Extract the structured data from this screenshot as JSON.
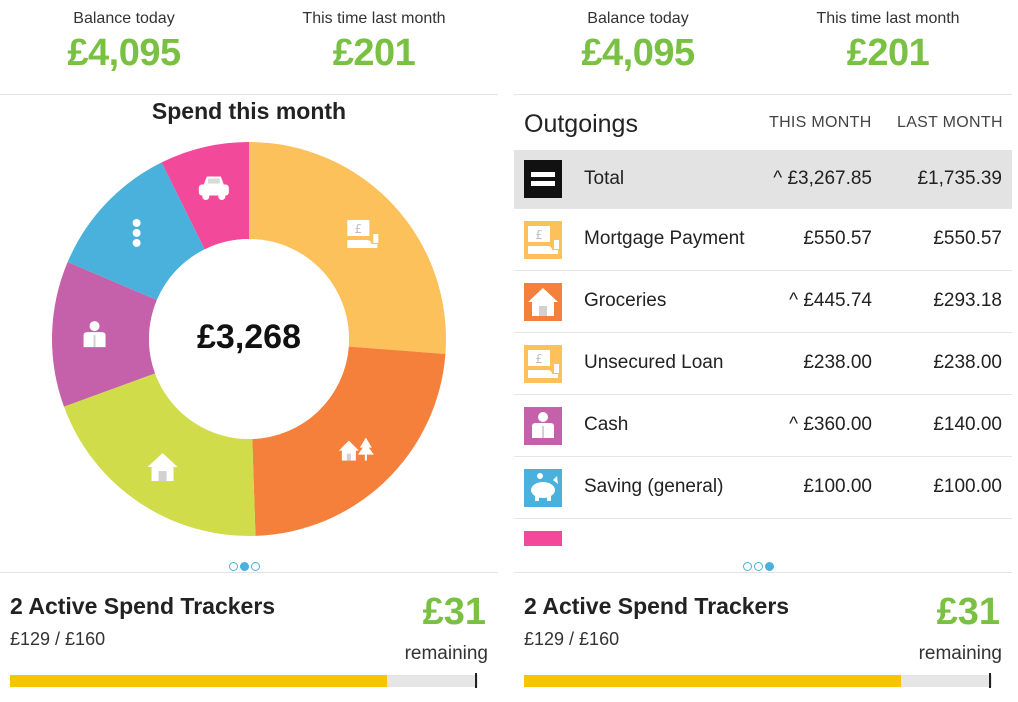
{
  "left_panel": {
    "header": {
      "balance_label": "Balance today",
      "balance_value": "£4,095",
      "last_month_label": "This time last month",
      "last_month_value": "£201"
    },
    "chart_title": "Spend this month",
    "center_value": "£3,268",
    "pager": {
      "active_index": 1,
      "count": 3
    },
    "tracker": {
      "title": "2 Active Spend Trackers",
      "subtitle": "£129 / £160",
      "amount": "£31",
      "remaining_label": "remaining",
      "progress_fraction": 0.806
    }
  },
  "right_panel": {
    "header": {
      "balance_label": "Balance today",
      "balance_value": "£4,095",
      "last_month_label": "This time last month",
      "last_month_value": "£201"
    },
    "outgoings": {
      "title": "Outgoings",
      "col_this_month": "THIS MONTH",
      "col_last_month": "LAST MONTH",
      "rows": [
        {
          "label": "Total",
          "this_month": "^ £3,267.85",
          "last_month": "£1,735.39",
          "icon": "total-icon",
          "color": "#111111"
        },
        {
          "label": "Mortgage Payment",
          "this_month": "£550.57",
          "last_month": "£550.57",
          "icon": "money-hand-icon",
          "color": "#fcc15a"
        },
        {
          "label": "Groceries",
          "this_month": "^ £445.74",
          "last_month": "£293.18",
          "icon": "house-icon",
          "color": "#f4803c"
        },
        {
          "label": "Unsecured Loan",
          "this_month": "£238.00",
          "last_month": "£238.00",
          "icon": "money-hand-icon",
          "color": "#fcc15a"
        },
        {
          "label": "Cash",
          "this_month": "^ £360.00",
          "last_month": "£140.00",
          "icon": "person-icon",
          "color": "#c560aa"
        },
        {
          "label": "Saving (general)",
          "this_month": "£100.00",
          "last_month": "£100.00",
          "icon": "piggy-bank-icon",
          "color": "#4ab0dc"
        }
      ]
    },
    "pager": {
      "active_index": 2,
      "count": 3
    },
    "tracker": {
      "title": "2 Active Spend Trackers",
      "subtitle": "£129 / £160",
      "amount": "£31",
      "remaining_label": "remaining",
      "progress_fraction": 0.806
    }
  },
  "colors": {
    "accent_green": "#7ac143",
    "tracker_yellow": "#f6c400",
    "pager_blue": "#4ab0dc"
  },
  "chart_data": {
    "type": "pie",
    "title": "Spend this month",
    "center_label": "£3,268",
    "slices": [
      {
        "icon": "money-hand-icon",
        "value": 788.57,
        "color": "#fcc15a"
      },
      {
        "icon": "house-tree-icon",
        "value": 700,
        "color": "#f4803c"
      },
      {
        "icon": "house-icon",
        "value": 600,
        "color": "#d1dc4a"
      },
      {
        "icon": "person-icon",
        "value": 360,
        "color": "#c560aa"
      },
      {
        "icon": "dots-icon",
        "value": 340,
        "color": "#4ab0dc"
      },
      {
        "icon": "car-icon",
        "value": 220,
        "color": "#f3499a"
      }
    ]
  }
}
